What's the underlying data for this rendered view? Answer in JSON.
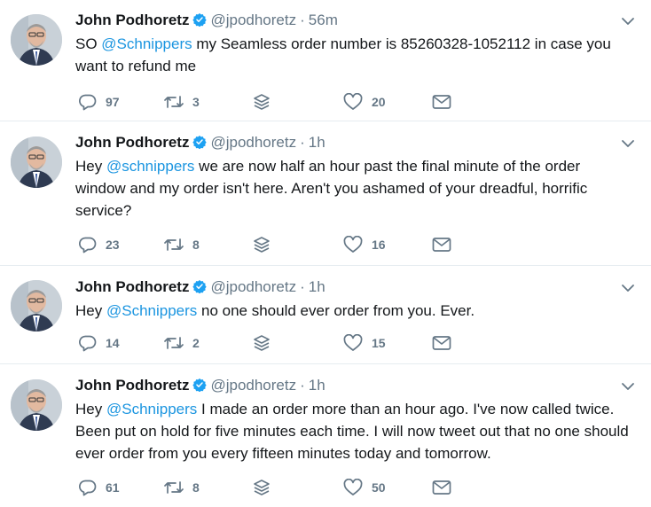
{
  "colors": {
    "mention": "#1b95e0",
    "secondary": "#657786",
    "verified": "#1da1f2",
    "divider": "#e6ecf0"
  },
  "icons": [
    "verified-badge-icon",
    "chevron-down-icon",
    "reply-icon",
    "retweet-icon",
    "stack-icon",
    "heart-icon",
    "envelope-icon"
  ],
  "tweets": [
    {
      "name": "John Podhoretz",
      "handle": "@jpodhoretz",
      "separator": "·",
      "time": "56m",
      "text": {
        "pre": "SO ",
        "mention": "@Schnippers",
        "post": " my Seamless order number is  85260328-1052112 in case you want to refund me"
      },
      "replies": "97",
      "retweets": "3",
      "likes": "20"
    },
    {
      "name": "John Podhoretz",
      "handle": "@jpodhoretz",
      "separator": "·",
      "time": "1h",
      "text": {
        "pre": "Hey ",
        "mention": "@schnippers",
        "post": " we are now half an hour past the final minute of the order window and my order isn't here. Aren't you ashamed of your dreadful, horrific service?"
      },
      "replies": "23",
      "retweets": "8",
      "likes": "16"
    },
    {
      "name": "John Podhoretz",
      "handle": "@jpodhoretz",
      "separator": "·",
      "time": "1h",
      "text": {
        "pre": "Hey ",
        "mention": "@Schnippers",
        "post": " no one should ever order from you. Ever."
      },
      "replies": "14",
      "retweets": "2",
      "likes": "15"
    },
    {
      "name": "John Podhoretz",
      "handle": "@jpodhoretz",
      "separator": "·",
      "time": "1h",
      "text": {
        "pre": "Hey ",
        "mention": "@Schnippers",
        "post": " I made an order more than an hour ago. I've now called twice. Been put on hold for five minutes each time. I will now tweet out that no one should ever order from you every fifteen minutes today and tomorrow."
      },
      "replies": "61",
      "retweets": "8",
      "likes": "50"
    }
  ]
}
